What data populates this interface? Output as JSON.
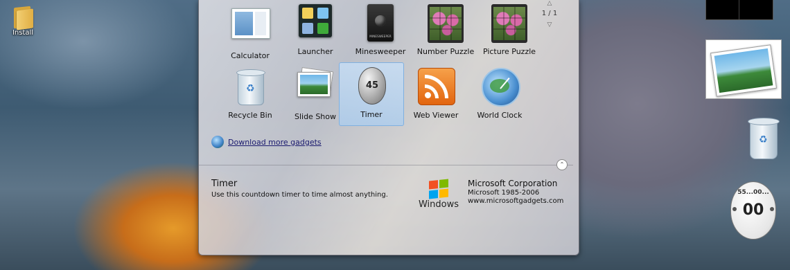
{
  "desktop": {
    "icon_label": "Install"
  },
  "gallery": {
    "pager": {
      "page_label": "1 / 1",
      "up_arrow": "△",
      "down_arrow": "▽"
    },
    "gadgets": [
      {
        "label": "Calculator"
      },
      {
        "label": "Launcher"
      },
      {
        "label": "Minesweeper",
        "icon_text": "MINESWEEPER"
      },
      {
        "label": "Number Puzzle"
      },
      {
        "label": "Picture Puzzle"
      },
      {
        "label": "Recycle Bin"
      },
      {
        "label": "Slide Show"
      },
      {
        "label": "Timer",
        "selected": true,
        "icon_text": "45"
      },
      {
        "label": "Web Viewer"
      },
      {
        "label": "World Clock"
      }
    ],
    "download_link": "Download more gadgets",
    "collapse_glyph": "⌃",
    "details": {
      "name": "Timer",
      "description": "Use this countdown timer to time almost anything.",
      "windows_logo_text": "Windows",
      "company": "Microsoft Corporation",
      "copyright": "Microsoft 1985-2006",
      "website": "www.microsoftgadgets.com"
    }
  },
  "sidebar": {
    "timer": {
      "ticks": "55...00...",
      "value": "00"
    }
  },
  "colors": {
    "selection_bg": "#bcd7f3",
    "selection_border": "#7fb0e0",
    "link": "#1a1a6e",
    "rss_orange": "#f08a2a"
  }
}
